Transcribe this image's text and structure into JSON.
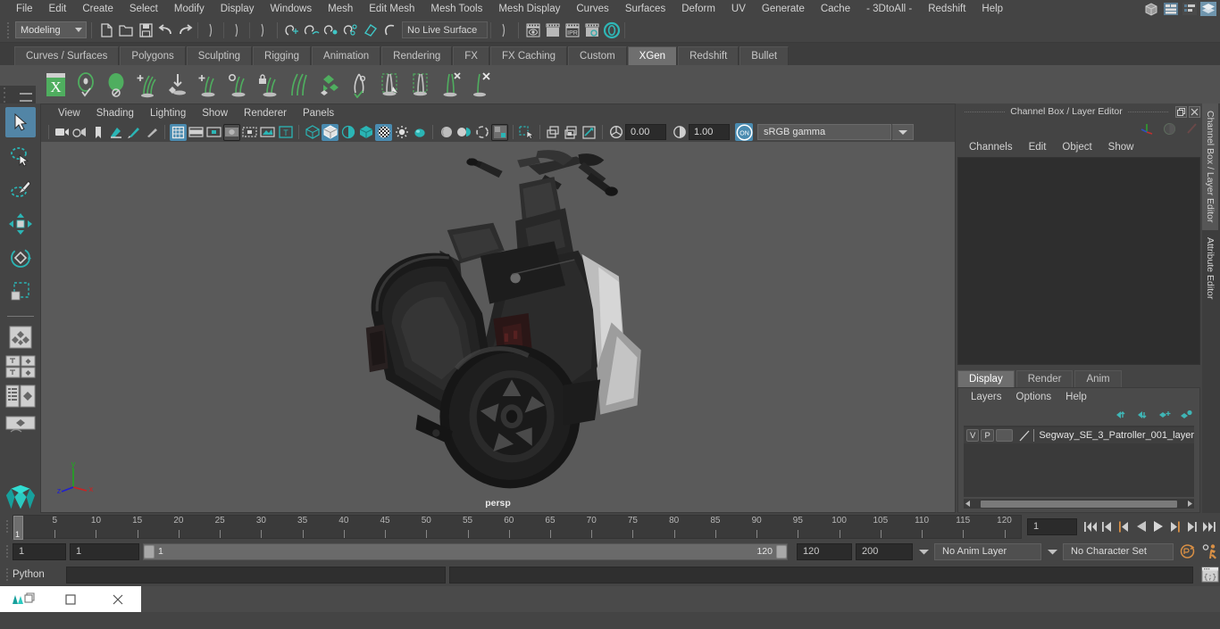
{
  "menubar": {
    "items": [
      "File",
      "Edit",
      "Create",
      "Select",
      "Modify",
      "Display",
      "Windows",
      "Mesh",
      "Edit Mesh",
      "Mesh Tools",
      "Mesh Display",
      "Curves",
      "Surfaces",
      "Deform",
      "UV",
      "Generate",
      "Cache",
      "- 3DtoAll -",
      "Redshift",
      "Help"
    ],
    "right_icons": [
      "modeling-toolkit-icon",
      "attribute-editor-icon",
      "tool-settings-icon",
      "channel-box-layer-editor-icon"
    ]
  },
  "statusline": {
    "mode": "Modeling",
    "live_surface": "No Live Surface",
    "icons": [
      "new-scene-icon",
      "open-scene-icon",
      "save-scene-icon",
      "undo-icon",
      "redo-icon",
      "select-by-hierarchy-icon",
      "select-by-object-icon",
      "select-by-component-icon",
      "snap-to-grid-icon",
      "snap-to-curve-icon",
      "snap-to-point-icon",
      "snap-to-projected-center-icon",
      "snap-to-view-plane-icon",
      "make-live-icon",
      "render-current-frame-icon",
      "ipr-render-icon",
      "render-settings-icon",
      "hypershade-icon",
      "render-view-icon"
    ]
  },
  "shelf": {
    "tabs": [
      "Curves / Surfaces",
      "Polygons",
      "Sculpting",
      "Rigging",
      "Animation",
      "Rendering",
      "FX",
      "FX Caching",
      "Custom",
      "XGen",
      "Redshift",
      "Bullet"
    ],
    "active_tab": "XGen",
    "buttons": [
      "xgen-editor-icon",
      "create-description-icon",
      "create-collection-icon",
      "add-guides-icon",
      "convert-to-interactive-icon",
      "add-grooming-icon",
      "density-brush-icon",
      "lock-guides-icon",
      "comb-brush-icon",
      "noise-brush-icon",
      "clump-modifier-icon",
      "cut-guides-icon",
      "select-guides-icon",
      "scale-guides-icon",
      "delete-guides-icon"
    ]
  },
  "viewport": {
    "menus": [
      "View",
      "Shading",
      "Lighting",
      "Show",
      "Renderer",
      "Panels"
    ],
    "exposure_value": "0.00",
    "gamma_value": "1.00",
    "color_space": "sRGB gamma",
    "camera_label": "persp",
    "axis": {
      "x": "x",
      "y": "y",
      "z": "z"
    },
    "toolbar_icons": [
      "select-camera-icon",
      "bookmark-camera-icon",
      "image-plane-icon",
      "two-d-pan-zoom-icon",
      "grease-pencil-icon",
      "grid-toggle-icon",
      "film-gate-icon",
      "resolution-gate-icon",
      "gate-mask-icon",
      "film-origin-icon",
      "safe-action-icon",
      "xray-text-icon",
      "wireframe-shaded-icon",
      "smooth-shade-all-icon",
      "shaded-wireframe-icon",
      "textured-icon",
      "use-all-lights-icon",
      "shadows-icon",
      "screen-space-ao-icon",
      "motion-blur-icon",
      "multisample-icon",
      "depth-of-field-icon",
      "isolate-select-icon",
      "xray-icon",
      "xray-joints-icon",
      "xray-active-components-icon",
      "exposure-icon",
      "gamma-icon",
      "color-management-icon"
    ]
  },
  "right_panel": {
    "title": "Channel Box / Layer Editor",
    "channel_menus": [
      "Channels",
      "Edit",
      "Object",
      "Show"
    ],
    "header_icons": [
      "transform-axis-icon",
      "shading-sphere-icon",
      "render-stripe-icon"
    ],
    "win_buttons": [
      "restore-icon",
      "close-icon"
    ],
    "layer_tabs": [
      "Display",
      "Render",
      "Anim"
    ],
    "active_layer_tab": "Display",
    "layer_menus": [
      "Layers",
      "Options",
      "Help"
    ],
    "layer_buttons": [
      "move-layer-up-icon",
      "move-layer-down-icon",
      "new-layer-icon",
      "new-layer-from-selected-icon"
    ],
    "layers": [
      {
        "visibility": "V",
        "playback": "P",
        "reference": "",
        "name": "Segway_SE_3_Patroller_001_layer"
      }
    ],
    "vertical_tabs": [
      "Channel Box / Layer Editor",
      "Attribute Editor"
    ],
    "active_vertical_tab": "Channel Box / Layer Editor"
  },
  "timeline": {
    "ticks": [
      5,
      10,
      15,
      20,
      25,
      30,
      35,
      40,
      45,
      50,
      55,
      60,
      65,
      70,
      75,
      80,
      85,
      90,
      95,
      100,
      105,
      110,
      115,
      120
    ],
    "current_frame_marker": "1",
    "current_frame_field": "1",
    "transport_icons": [
      "go-to-start-icon",
      "step-back-keyframe-icon",
      "step-back-frame-icon",
      "play-backwards-icon",
      "play-forwards-icon",
      "step-forward-frame-icon",
      "step-forward-keyframe-icon",
      "go-to-end-icon"
    ]
  },
  "range": {
    "anim_start": "1",
    "range_start": "1",
    "slider_low": "1",
    "slider_high": "120",
    "range_end": "120",
    "anim_end": "200",
    "anim_layer": "No Anim Layer",
    "character_set": "No Character Set",
    "icons": [
      "auto-keyframe-icon",
      "animation-preferences-icon"
    ]
  },
  "command_line": {
    "label": "Python",
    "input_value": "",
    "output_value": "",
    "script_editor_icon": "script-editor-icon"
  },
  "taskbar": {
    "buttons": [
      "maya-restore-icon",
      "maximize-icon",
      "close-icon"
    ]
  },
  "colors": {
    "accent_blue": "#4a8bb0",
    "select_blue": "#5285a6",
    "shelf_green": "#5aa86a",
    "teal": "#2bb5b5",
    "orange": "#d88f45",
    "panel_bg": "#444444",
    "viewport_bg": "#5a5a5a"
  }
}
